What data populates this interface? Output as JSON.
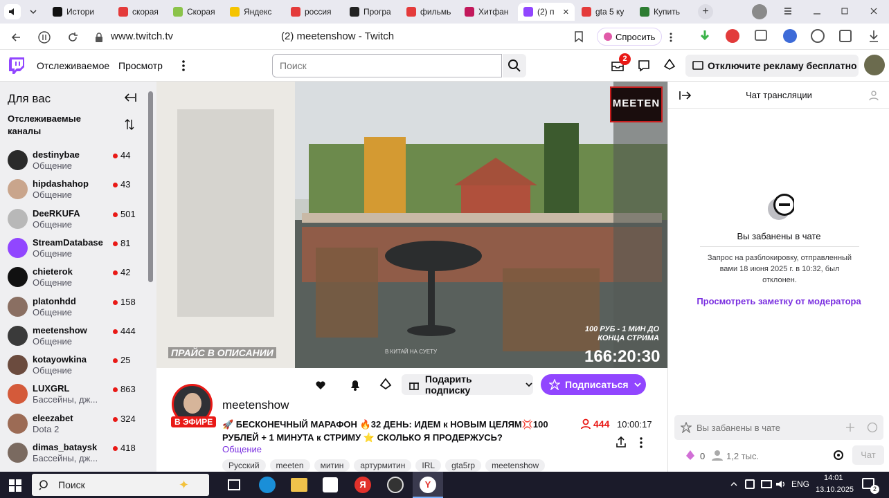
{
  "browser": {
    "tabs": [
      {
        "label": "",
        "color": "#444"
      },
      {
        "label": "Истори",
        "color": "#111111"
      },
      {
        "label": "скорая",
        "color": "#e43b3b"
      },
      {
        "label": "Скорая",
        "color": "#8bc34a"
      },
      {
        "label": "Яндекс",
        "color": "#f5c400"
      },
      {
        "label": "россия",
        "color": "#e43b3b"
      },
      {
        "label": "Програ",
        "color": "#222222"
      },
      {
        "label": "фильмь",
        "color": "#e43b3b"
      },
      {
        "label": "Хитфан",
        "color": "#c2185b"
      },
      {
        "label": "(2) п",
        "color": "#9146ff"
      },
      {
        "label": "gta 5 ку",
        "color": "#e43b3b"
      },
      {
        "label": "Купить",
        "color": "#2e7d32"
      }
    ],
    "url": "www.twitch.tv",
    "page_title": "(2) meetenshow - Twitch",
    "ask_label": "Спросить"
  },
  "nav": {
    "following": "Отслеживаемое",
    "browse": "Просмотр",
    "search_placeholder": "Поиск",
    "notif_count": "2",
    "ads_label": "Отключите рекламу бесплатно"
  },
  "sidebar": {
    "heading": "Для вас",
    "section": "Отслеживаемые каналы",
    "channels": [
      {
        "name": "destinybae",
        "category": "Общение",
        "viewers": "44",
        "color": "#2a2a2a"
      },
      {
        "name": "hipdashahop",
        "category": "Общение",
        "viewers": "43",
        "color": "#c9a58c"
      },
      {
        "name": "DeeRKUFA",
        "category": "Общение",
        "viewers": "501",
        "color": "#b8b8b8"
      },
      {
        "name": "StreamDatabase",
        "category": "Общение",
        "viewers": "81",
        "color": "#9146ff"
      },
      {
        "name": "chieterok",
        "category": "Общение",
        "viewers": "42",
        "color": "#111111"
      },
      {
        "name": "platonhdd",
        "category": "Общение",
        "viewers": "158",
        "color": "#8a6f62"
      },
      {
        "name": "meetenshow",
        "category": "Общение",
        "viewers": "444",
        "color": "#3a3a3a"
      },
      {
        "name": "kotayowkina",
        "category": "Общение",
        "viewers": "25",
        "color": "#6b4b3e"
      },
      {
        "name": "LUXGRL",
        "category": "Бассейны, дж...",
        "viewers": "863",
        "color": "#d45a3a"
      },
      {
        "name": "eleezabet",
        "category": "Dota 2",
        "viewers": "324",
        "color": "#9c6b55"
      },
      {
        "name": "dimas_bataysk",
        "category": "Бассейны, дж...",
        "viewers": "418",
        "color": "#7a6a60"
      }
    ]
  },
  "video": {
    "brand": "MEETEN",
    "price_caption": "ПРАЙС В ОПИСАНИИ",
    "rate_caption": "100 РУБ - 1 МИН ДО КОНЦА СТРИМА",
    "countdown": "166:20:30",
    "goal_caption": "В КИТАЙ НА СУЕТУ"
  },
  "stream": {
    "channel": "meetenshow",
    "live_badge": "В ЭФИРЕ",
    "gift_sub": "Подарить подписку",
    "subscribe": "Подписаться",
    "title": "🚀 БЕСКОНЕЧНЫЙ МАРАФОН 🔥32 ДЕНЬ: ИДЕМ к НОВЫМ ЦЕЛЯМ💢100 РУБЛЕЙ + 1 МИНУТА к СТРИМУ ⭐ СКОЛЬКО Я ПРОДЕРЖУСЬ?",
    "category": "Общение",
    "viewers": "444",
    "uptime": "10:00:17",
    "tags": [
      "Русский",
      "meeten",
      "митин",
      "артурмитин",
      "IRL",
      "gta5rp",
      "meetenshow"
    ]
  },
  "chat": {
    "header": "Чат трансляции",
    "banned_title": "Вы забанены в чате",
    "unban_text": "Запрос на разблокировку, отправленный вами 18 июня 2025 г. в 10:32, был отклонен.",
    "mod_note_link": "Просмотреть заметку от модератора",
    "input_placeholder": "Вы забанены в чате",
    "points": "0",
    "viewers_count": "1,2 тыс.",
    "send_label": "Чат",
    "accent": "#9146ff"
  },
  "taskbar": {
    "search_label": "Поиск",
    "lang": "ENG",
    "time": "14:01",
    "date": "13.10.2025",
    "notif": "2"
  }
}
